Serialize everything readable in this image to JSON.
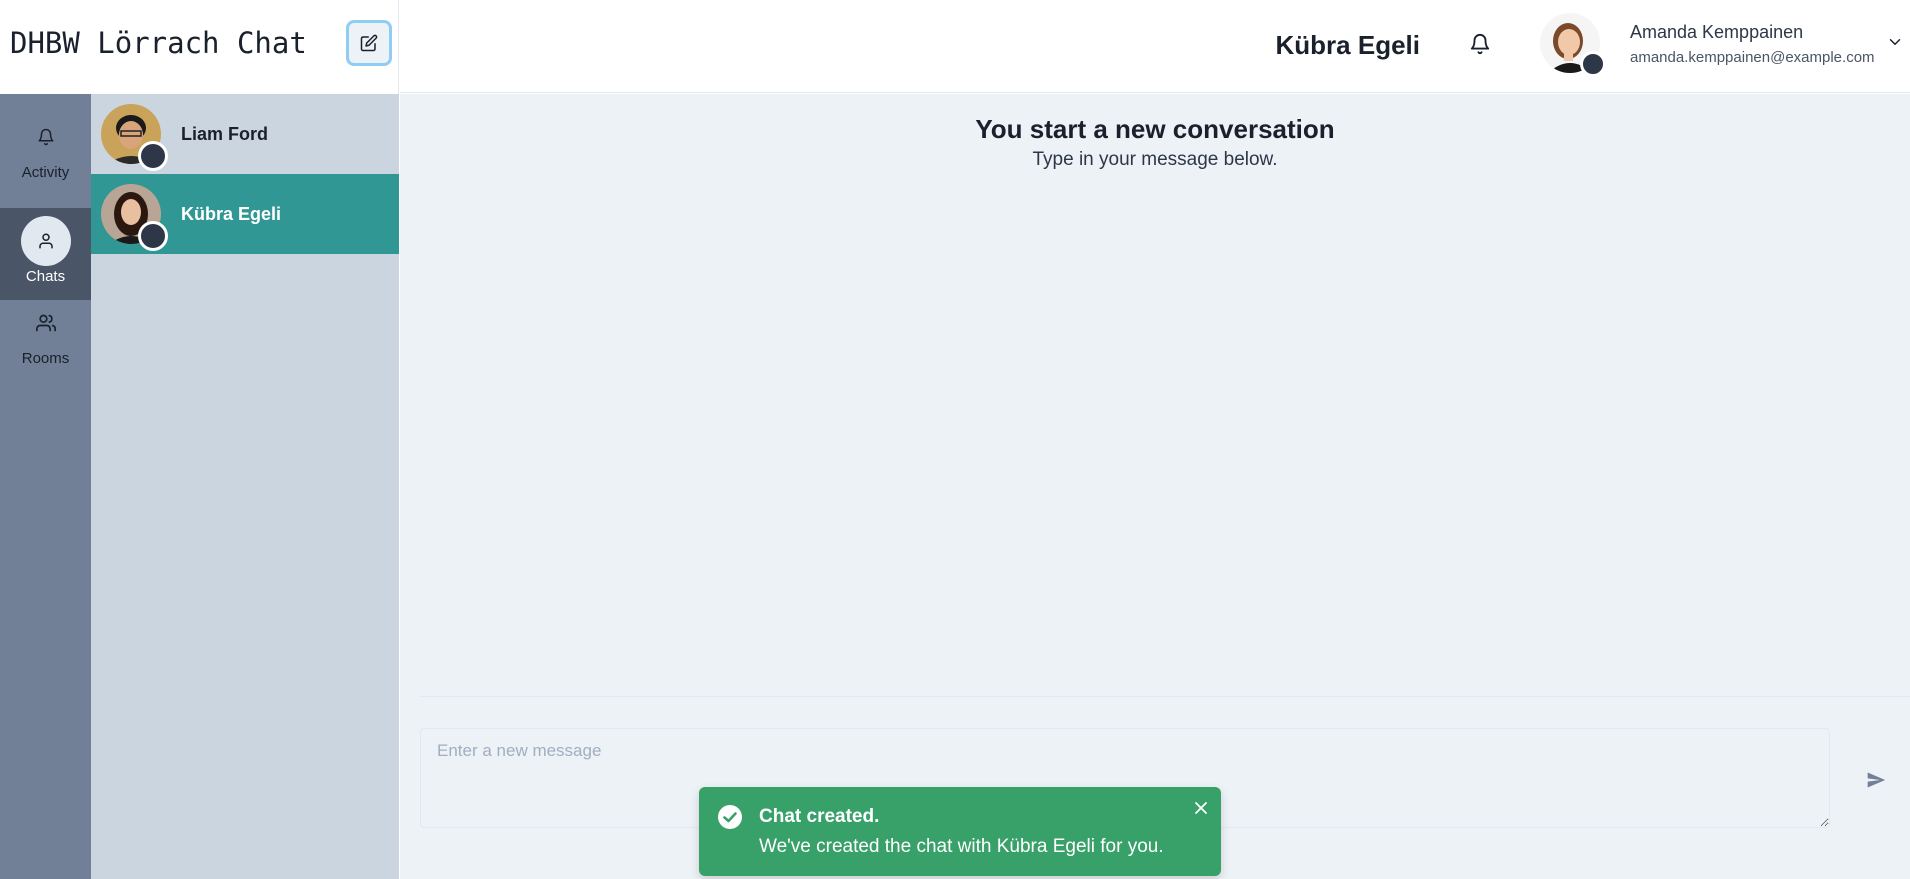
{
  "app": {
    "title": "DHBW Lörrach Chat",
    "new_chat_icon": "edit-icon"
  },
  "header": {
    "chat_title": "Kübra Egeli",
    "notification_icon": "bell-icon",
    "user": {
      "name": "Amanda Kemppainen",
      "email": "amanda.kemppainen@example.com",
      "menu_icon": "chevron-down-icon"
    }
  },
  "nav": {
    "items": [
      {
        "label": "Activity",
        "icon": "bell-icon",
        "active": false
      },
      {
        "label": "Chats",
        "icon": "user-icon",
        "active": true
      },
      {
        "label": "Rooms",
        "icon": "users-icon",
        "active": false
      }
    ]
  },
  "chats": {
    "items": [
      {
        "name": "Liam Ford",
        "selected": false
      },
      {
        "name": "Kübra Egeli",
        "selected": true
      }
    ]
  },
  "conversation": {
    "empty_title": "You start a new conversation",
    "empty_subtitle": "Type in your message below.",
    "input_placeholder": "Enter a new message",
    "input_value": "",
    "send_icon": "send-icon"
  },
  "toast": {
    "title": "Chat created.",
    "message": "We've created the chat with Kübra Egeli for you.",
    "status_icon": "check-circle-icon",
    "close_icon": "close-icon"
  },
  "colors": {
    "accent": "#319795",
    "success": "#38a169",
    "nav_bg": "#718096",
    "nav_active": "#4a5568",
    "list_bg": "#cbd5e0",
    "main_bg": "#edf2f7"
  }
}
